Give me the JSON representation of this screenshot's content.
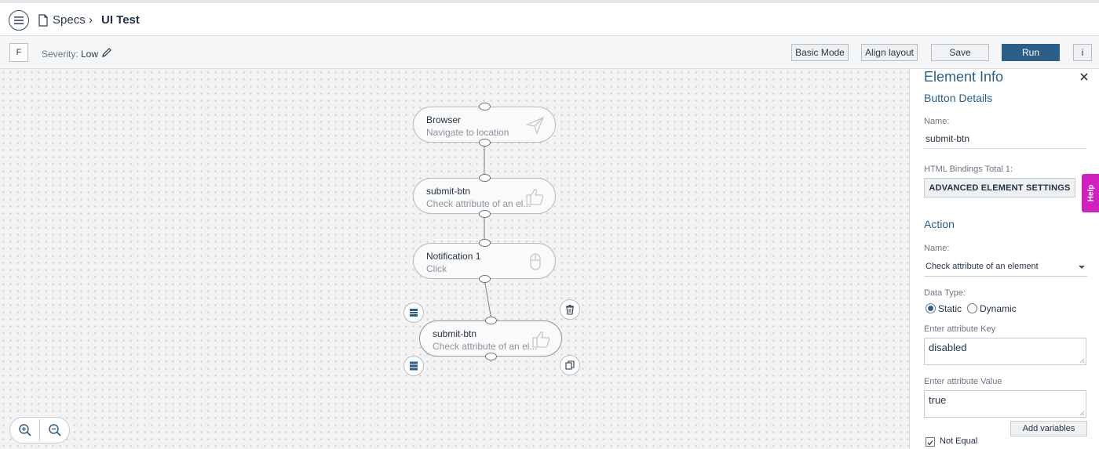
{
  "header": {
    "breadcrumb_root": "Specs",
    "breadcrumb_separator": "›",
    "breadcrumb_current": "UI Test"
  },
  "toolbar": {
    "f_label": "F",
    "severity_label": "Severity:",
    "severity_value": "Low",
    "basic_mode_label": "Basic Mode",
    "align_layout_label": "Align layout",
    "save_label": "Save",
    "run_label": "Run",
    "info_label": "i"
  },
  "flow": {
    "nodes": [
      {
        "title": "Browser",
        "subtitle": "Navigate to location",
        "icon": "send-icon"
      },
      {
        "title": "submit-btn",
        "subtitle": "Check attribute of an el...",
        "icon": "thumbs-up-icon"
      },
      {
        "title": "Notification 1",
        "subtitle": "Click",
        "icon": "mouse-icon"
      },
      {
        "title": "submit-btn",
        "subtitle": "Check attribute of an el...",
        "icon": "thumbs-up-icon",
        "selected": true
      }
    ]
  },
  "panel": {
    "title": "Element Info",
    "button_details_heading": "Button Details",
    "name_label": "Name:",
    "name_value": "submit-btn",
    "html_bindings_label": "HTML Bindings Total 1:",
    "advanced_settings_label": "ADVANCED ELEMENT SETTINGS",
    "help_label": "Help",
    "action_heading": "Action",
    "action_name_label": "Name:",
    "action_name_value": "Check attribute of an element",
    "data_type_label": "Data Type:",
    "data_type_options": [
      "Static",
      "Dynamic"
    ],
    "data_type_selected": "Static",
    "attr_key_label": "Enter attribute Key",
    "attr_key_value": "disabled",
    "attr_value_label": "Enter attribute Value",
    "attr_value_value": "true",
    "add_variables_label": "Add variables",
    "not_equal_label": "Not Equal",
    "not_equal_checked": true
  },
  "colors": {
    "accent": "#2c5f88",
    "help_tab": "#d21fc0"
  }
}
